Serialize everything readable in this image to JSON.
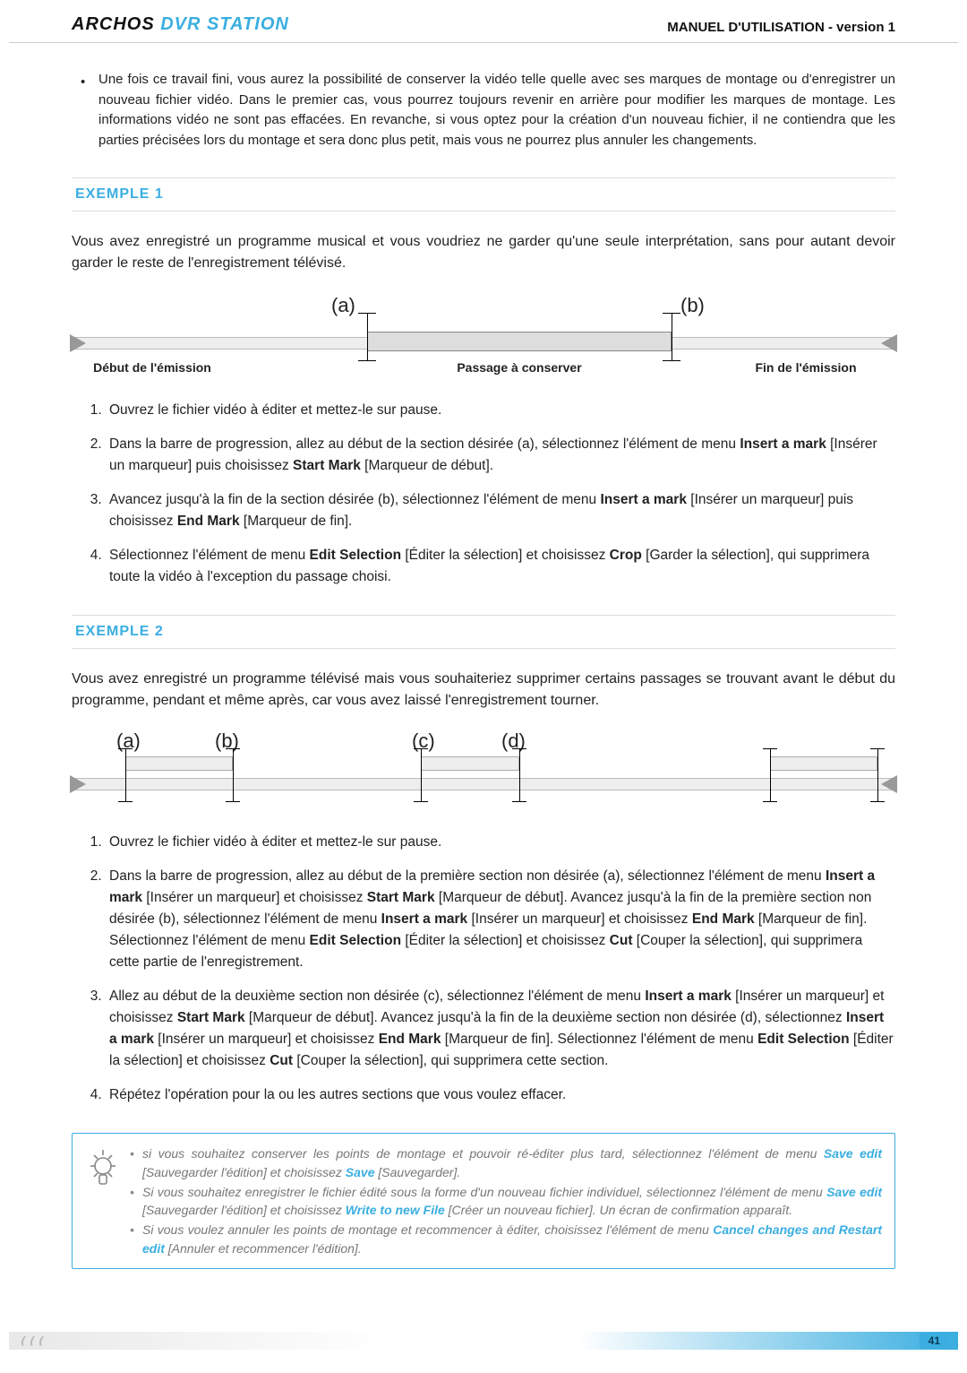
{
  "header": {
    "brand_archos": "ARCHOS",
    "brand_product": "DVR STATION",
    "doc_title": "MANUEL D'UTILISATION - version 1"
  },
  "intro_bullet": "Une fois ce travail fini, vous aurez la possibilité de conserver la vidéo telle quelle avec ses marques de montage ou d'enregistrer un nouveau fichier vidéo. Dans le premier cas, vous pourrez toujours revenir en arrière pour modifier les marques de montage. Les informations vidéo ne sont pas effacées. En revanche, si vous optez pour la création d'un nouveau fichier, il ne contiendra que les parties précisées lors du montage et sera donc plus petit, mais vous ne pourrez plus annuler les changements.",
  "ex1": {
    "title": "EXEMPLE 1",
    "para": "Vous avez enregistré un programme musical et vous voudriez ne garder qu'une seule interprétation, sans pour autant devoir garder le reste de l'enregistrement télévisé.",
    "label_a": "(a)",
    "label_b": "(b)",
    "cap_start": "Début de l'émission",
    "cap_keep": "Passage à conserver",
    "cap_end": "Fin de l'émission",
    "steps": [
      "Ouvrez le fichier vidéo à éditer et mettez-le sur pause.",
      "Dans la barre de progression, allez au début de la section désirée (a), sélectionnez l'élément de menu <b>Insert a mark</b> [Insérer un marqueur] puis choisissez <b>Start Mark</b> [Marqueur de début].",
      "Avancez jusqu'à la fin de la section désirée (b), sélectionnez l'élément de menu <b>Insert a mark</b> [Insérer un marqueur] puis choisissez <b>End Mark</b> [Marqueur de fin].",
      "Sélectionnez l'élément de menu <b>Edit Selection</b> [Éditer la sélection] et choisissez <b>Crop</b> [Garder la sélection], qui supprimera toute la vidéo à l'exception du passage choisi."
    ]
  },
  "ex2": {
    "title": "EXEMPLE 2",
    "para": "Vous avez enregistré un programme télévisé mais vous souhaiteriez supprimer certains passages se trouvant avant le début du programme, pendant et même après, car vous avez laissé l'enregistrement tourner.",
    "label_a": "(a)",
    "label_b": "(b)",
    "label_c": "(c)",
    "label_d": "(d)",
    "steps": [
      "Ouvrez le fichier vidéo à éditer et mettez-le sur pause.",
      "Dans la barre de progression, allez au début de la première section non désirée (a), sélectionnez l'élément de menu <b>Insert a mark</b> [Insérer un marqueur] et choisissez <b>Start Mark</b> [Marqueur de début]. Avancez jusqu'à la fin de la première section non désirée (b), sélectionnez l'élément de menu <b>Insert a mark</b> [Insérer un marqueur] et choisissez <b>End Mark</b> [Marqueur de fin]. Sélectionnez l'élément de menu <b>Edit Selection</b> [Éditer la sélection] et choisissez <b>Cut</b> [Couper la sélection], qui supprimera cette partie de l'enregistrement.",
      "Allez au début de la deuxième section non désirée (c), sélectionnez l'élément de menu <b>Insert a mark</b> [Insérer un marqueur] et choisissez <b>Start Mark</b> [Marqueur de début]. Avancez jusqu'à la fin de la deuxième section non désirée (d), sélectionnez <b>Insert a mark</b> [Insérer un marqueur] et choisissez <b>End Mark</b> [Marqueur de fin]. Sélectionnez l'élément de menu <b>Edit Selection</b> [Éditer la sélection] et choisissez <b>Cut</b> [Couper la sélection], qui supprimera cette section.",
      "Répétez l'opération pour la ou les autres sections que vous voulez effacer."
    ]
  },
  "tip": {
    "items": [
      "si vous souhaitez conserver les points de montage et pouvoir ré‑éditer plus tard, sélectionnez l'élément de menu <b class='hl'>Save edit</b> [Sauvegarder l'édition] et choisissez <b class='hl'>Save</b> [Sauvegarder].",
      "Si vous souhaitez enregistrer le fichier édité sous la forme d'un nouveau fichier individuel, sélectionnez l'élément de menu <b class='hl'>Save edit</b> [Sauvegarder l'édition] et choisissez <b class='hl'>Write to new File</b> [Créer un nouveau fichier]. Un écran de confirmation apparaît.",
      "Si vous voulez annuler les points de montage et recommencer à éditer, choisissez l'élément de menu <b class='hl'>Cancel changes and Restart edit</b> [Annuler et recommencer l'édition]."
    ]
  },
  "footer": {
    "left": "❪❪❪",
    "page": "41"
  }
}
